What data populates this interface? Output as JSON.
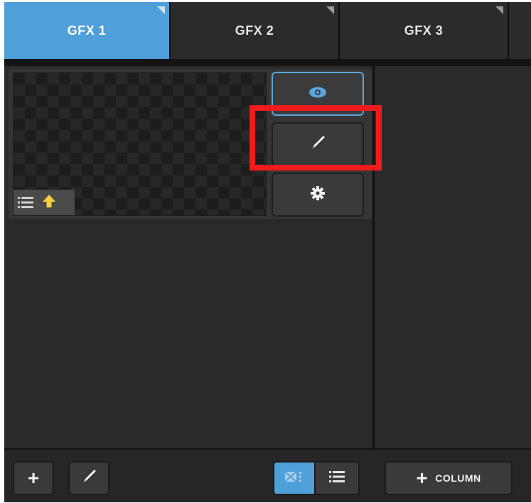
{
  "tabs": [
    {
      "label": "GFX 1",
      "active": true
    },
    {
      "label": "GFX 2",
      "active": false
    },
    {
      "label": "GFX 3",
      "active": false
    }
  ],
  "item_card": {
    "actions": [
      "view",
      "edit",
      "settings"
    ],
    "icons": {
      "view": "eye-icon",
      "edit": "brush-icon",
      "settings": "gear-icon",
      "badge_list": "list-icon",
      "badge_up": "arrow-up-icon"
    }
  },
  "toolbar": {
    "add_icon": "+",
    "add_column_plus": "+",
    "add_column_label": "COLUMN",
    "view_mode": "grid"
  },
  "colors": {
    "accent": "#4f9fd8",
    "highlight": "#ee1c1c",
    "badge_arrow": "#f4d03f"
  }
}
